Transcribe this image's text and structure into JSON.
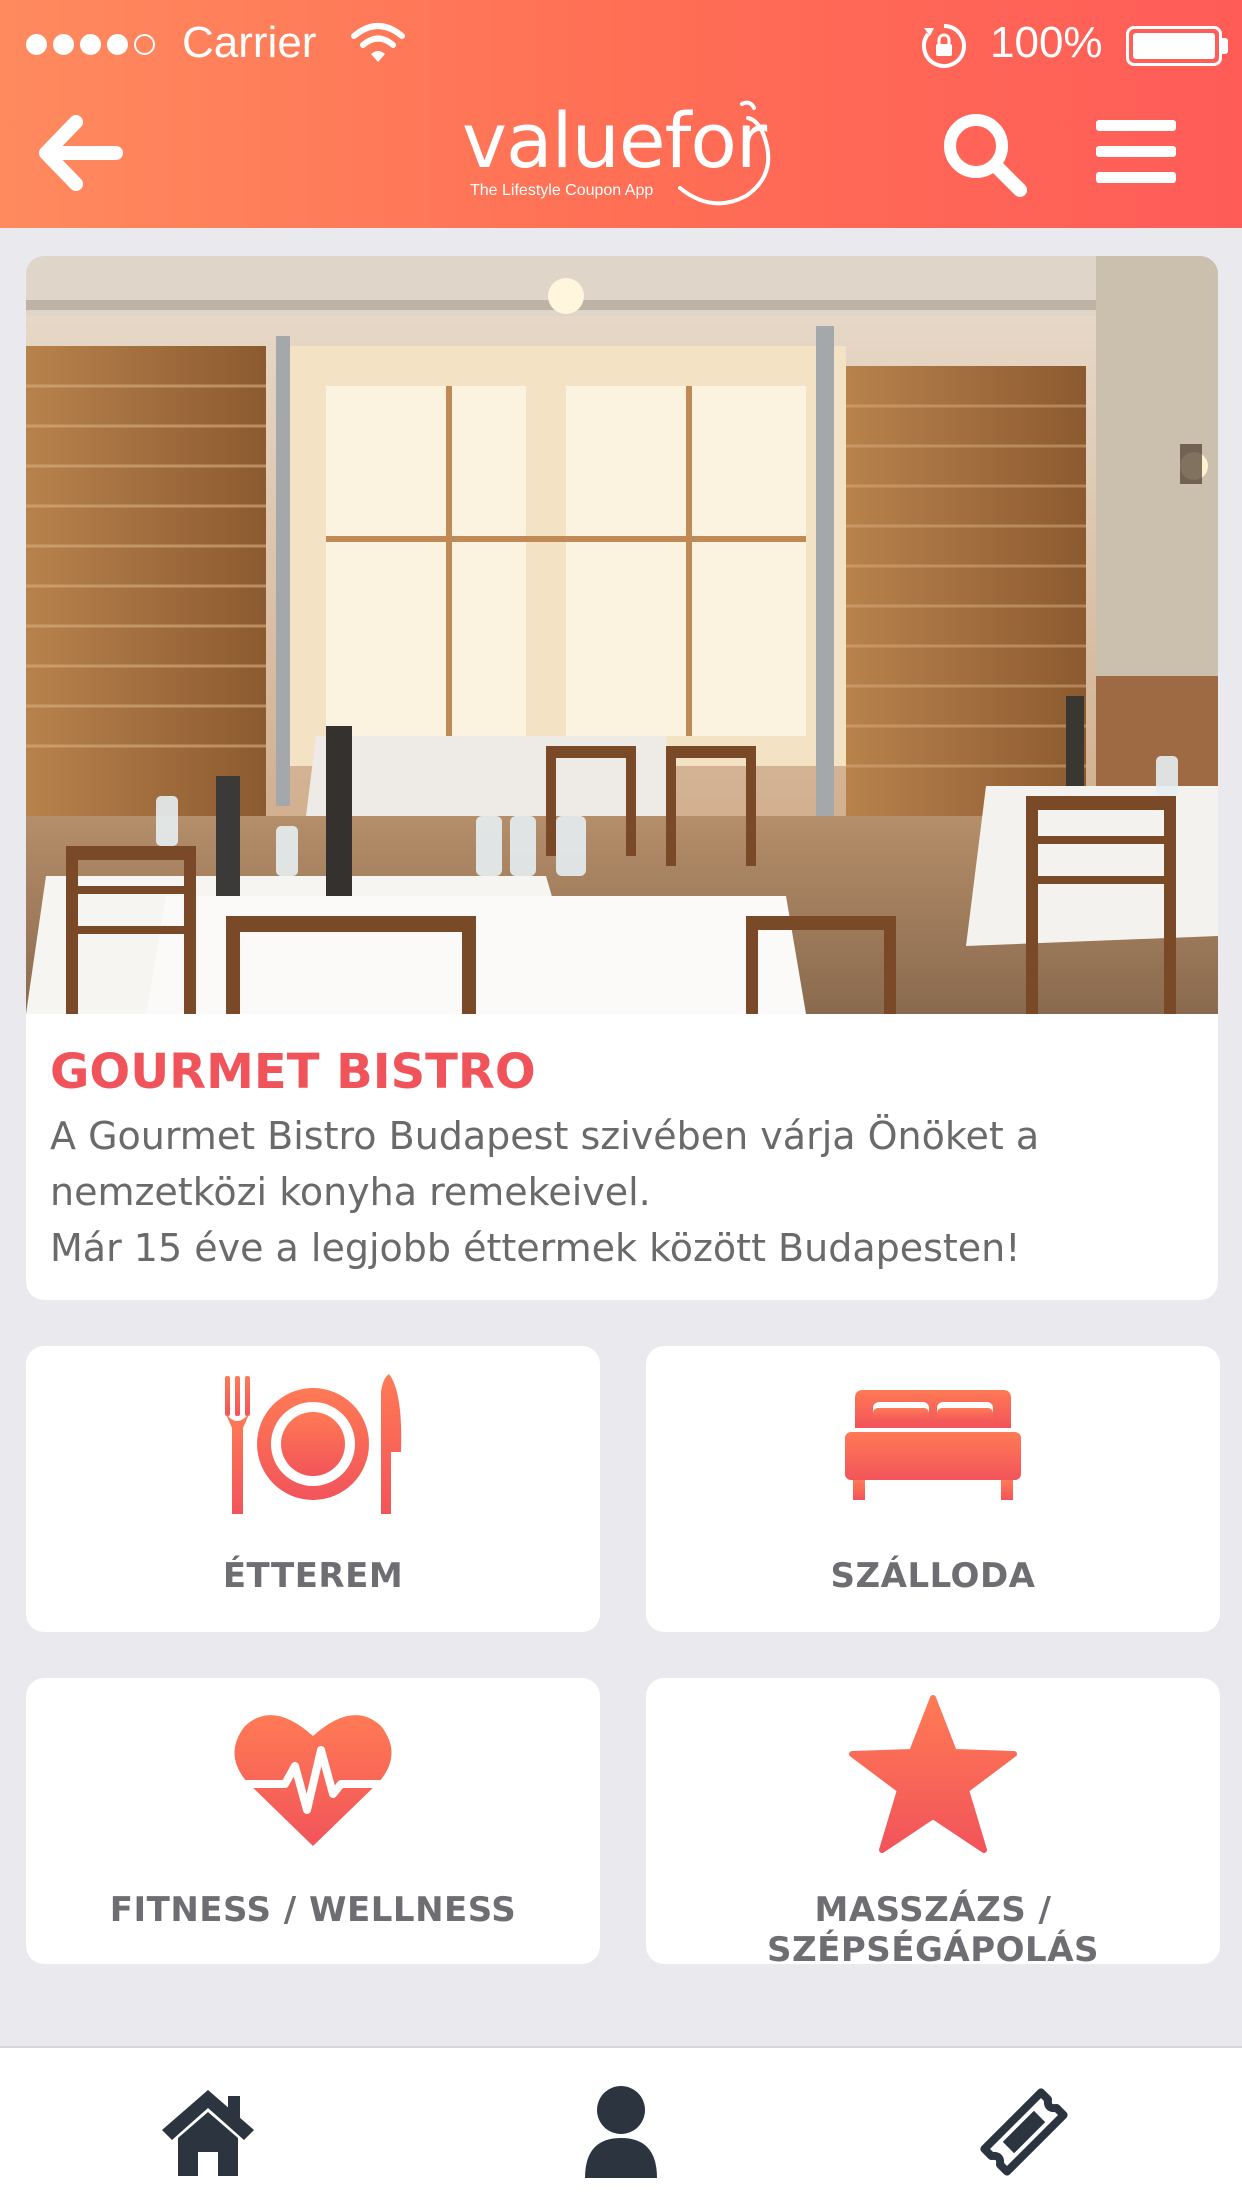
{
  "status_bar": {
    "carrier": "Carrier",
    "battery": "100%",
    "signal_bars_filled": 4,
    "signal_bars_total": 5
  },
  "header": {
    "logo_text": "valuefor",
    "logo_tagline": "The Lifestyle Coupon App",
    "icons": [
      "back-arrow-icon",
      "search-icon",
      "hamburger-menu-icon"
    ]
  },
  "featured": {
    "title": "GOURMET BISTRO",
    "description_lines": [
      "A Gourmet Bistro Budapest szivében várja Önöket a",
      "nemzetközi konyha remekeivel.",
      "Már 15 éve a legjobb éttermek között Budapesten!"
    ]
  },
  "categories": [
    {
      "label": "ÉTTEREM",
      "icon": "fork-plate-knife-icon"
    },
    {
      "label": "SZÁLLODA",
      "icon": "bed-icon"
    },
    {
      "label": "FITNESS / WELLNESS",
      "icon": "heart-pulse-icon"
    },
    {
      "label": "MASSZÁZS / SZÉPSÉGÁPOLÁS",
      "icon": "star-icon"
    }
  ],
  "tab_bar": {
    "icons": [
      "home-icon",
      "user-icon",
      "ticket-icon"
    ]
  },
  "colors": {
    "accent": "#f0545a",
    "header_gradient_start": "#ff8a5e",
    "header_gradient_end": "#ff5c58",
    "tab_icon": "#2c3440",
    "label_gray": "#6d6d72"
  }
}
